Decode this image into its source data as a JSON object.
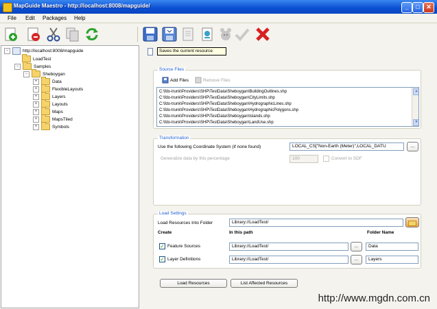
{
  "window": {
    "title": "MapGuide Maestro - http://localhost:8008/mapguide/",
    "controls": {
      "minimize": "_",
      "maximize": "□",
      "close": "✕"
    }
  },
  "menu": [
    "File",
    "Edit",
    "Packages",
    "Help"
  ],
  "toolbar_left": [
    {
      "icon": "new-green-icon"
    },
    {
      "icon": "delete-red-icon"
    },
    {
      "icon": "cut-scissors-icon"
    },
    {
      "icon": "copy-icon"
    },
    {
      "icon": "refresh-icon"
    }
  ],
  "toolbar_right": [
    {
      "icon": "save-icon"
    },
    {
      "icon": "save-as-icon"
    },
    {
      "icon": "copy-doc-icon"
    },
    {
      "icon": "preview-icon"
    },
    {
      "icon": "profile-icon"
    },
    {
      "icon": "validate-check-icon"
    },
    {
      "icon": "close-x-icon"
    }
  ],
  "tooltip": "Saves the current resource",
  "tree": {
    "root": "http://localhost:8008/mapguide",
    "items": [
      {
        "label": "LoadTest",
        "level": 1,
        "expander": ""
      },
      {
        "label": "Samples",
        "level": 1,
        "expander": "−"
      },
      {
        "label": "Sheboygan",
        "level": 2,
        "expander": "−"
      },
      {
        "label": "Data",
        "level": 3,
        "expander": "+"
      },
      {
        "label": "FlexibleLayouts",
        "level": 3,
        "expander": "+"
      },
      {
        "label": "Layers",
        "level": 3,
        "expander": "+"
      },
      {
        "label": "Layouts",
        "level": 3,
        "expander": "+"
      },
      {
        "label": "Maps",
        "level": 3,
        "expander": "+"
      },
      {
        "label": "MapsTiled",
        "level": 3,
        "expander": "+"
      },
      {
        "label": "Symbols",
        "level": 3,
        "expander": "+"
      }
    ]
  },
  "source_files": {
    "legend": "Source Files",
    "add_label": "Add Files",
    "remove_label": "Remove Files",
    "files": [
      "C:\\fdo-trunk\\Providers\\SHP\\TestData\\Sheboygan\\BuildingOutlines.shp",
      "C:\\fdo-trunk\\Providers\\SHP\\TestData\\Sheboygan\\CityLimits.shp",
      "C:\\fdo-trunk\\Providers\\SHP\\TestData\\Sheboygan\\HydrographicLines.shp",
      "C:\\fdo-trunk\\Providers\\SHP\\TestData\\Sheboygan\\HydrographicPolygons.shp",
      "C:\\fdo-trunk\\Providers\\SHP\\TestData\\Sheboygan\\Islands.shp",
      "C:\\fdo-trunk\\Providers\\SHP\\TestData\\Sheboygan\\LandUse.shp"
    ]
  },
  "transformation": {
    "legend": "Transformation",
    "coord_label": "Use the following Coordinate System (if none found)",
    "coord_value": "LOCAL_CS[\"Non-Earth (Meter)\",LOCAL_DATU",
    "browse_label": "...",
    "generalize_label": "Generalize data by this percentage",
    "generalize_value": "100",
    "convert_label": "Convert to SDF"
  },
  "load_settings": {
    "legend": "Load Settings",
    "folder_label": "Load Resources Into Folder",
    "folder_value": "Library://LoadTest/",
    "col_create": "Create",
    "col_path": "In this path",
    "col_folder": "Folder Name",
    "rows": [
      {
        "label": "Feature Sources",
        "path": "Library://LoadTest/",
        "folder": "Data"
      },
      {
        "label": "Layer Definitions",
        "path": "Library://LoadTest/",
        "folder": "Layers"
      }
    ],
    "browse_label": "..."
  },
  "buttons": {
    "load": "Load Resources",
    "list": "List Affected Resources"
  },
  "watermark": "http://www.mgdn.com.cn"
}
